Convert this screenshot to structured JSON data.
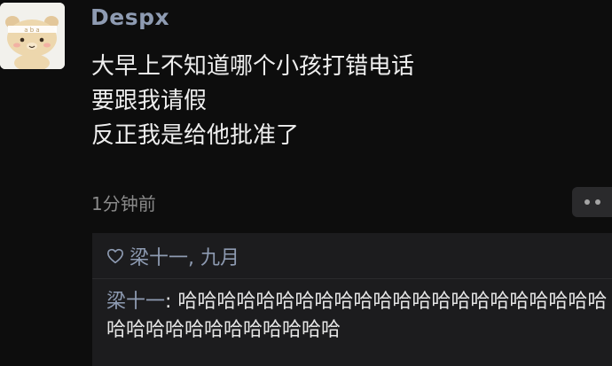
{
  "post": {
    "author": "Despx",
    "lines": [
      "大早上不知道哪个小孩打错电话",
      "要跟我请假",
      "反正我是给他批准了"
    ],
    "timestamp": "1分钟前"
  },
  "likes": {
    "icon": "heart-outline-icon",
    "names": "梁十一, 九月"
  },
  "comment": {
    "author": "梁十一",
    "separator": ": ",
    "text": "哈哈哈哈哈哈哈哈哈哈哈哈哈哈哈哈哈哈哈哈哈哈哈哈哈哈哈哈哈哈哈哈哈哈"
  },
  "colors": {
    "background": "#0d0d0d",
    "name_blue": "#8e9bb2",
    "panel": "#1c1c1e"
  }
}
